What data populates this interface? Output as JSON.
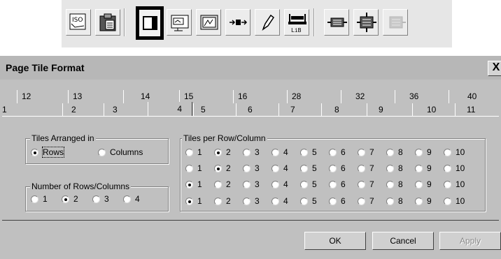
{
  "toolbar": {
    "buttons": [
      {
        "icon": "iso-icon"
      },
      {
        "icon": "clipboard-icon"
      },
      {
        "icon": "page-tile-icon",
        "selected": true
      },
      {
        "icon": "screen-display-icon"
      },
      {
        "icon": "chart-frame-icon"
      },
      {
        "icon": "arrow-flow-icon"
      },
      {
        "icon": "pencil-icon"
      },
      {
        "icon": "library-icon",
        "text": "LiB"
      },
      {
        "icon": "module-in-icon"
      },
      {
        "icon": "module-split-icon"
      },
      {
        "icon": "module-disabled-icon",
        "disabled": true
      }
    ]
  },
  "dialog": {
    "title": "Page Tile Format",
    "close_glyph": "X",
    "tabs_back_row": [
      "12",
      "13",
      "14",
      "15",
      "16",
      "28",
      "32",
      "36",
      "40"
    ],
    "tabs_front_row": [
      "1",
      "2",
      "3",
      "4",
      "5",
      "6",
      "7",
      "8",
      "9",
      "10",
      "11"
    ],
    "active_tab": "4",
    "tiles_arranged": {
      "legend": "Tiles Arranged in",
      "options": [
        "Rows",
        "Columns"
      ],
      "selected": "Rows"
    },
    "rows_columns": {
      "legend": "Number of Rows/Columns",
      "options": [
        "1",
        "2",
        "3",
        "4"
      ],
      "selected": "2"
    },
    "tiles_per": {
      "legend": "Tiles per Row/Column",
      "options": [
        "1",
        "2",
        "3",
        "4",
        "5",
        "6",
        "7",
        "8",
        "9",
        "10"
      ],
      "rows_selected": [
        "2",
        "2",
        "1",
        "1"
      ]
    },
    "buttons": {
      "ok": "OK",
      "cancel": "Cancel",
      "apply": "Apply"
    }
  }
}
